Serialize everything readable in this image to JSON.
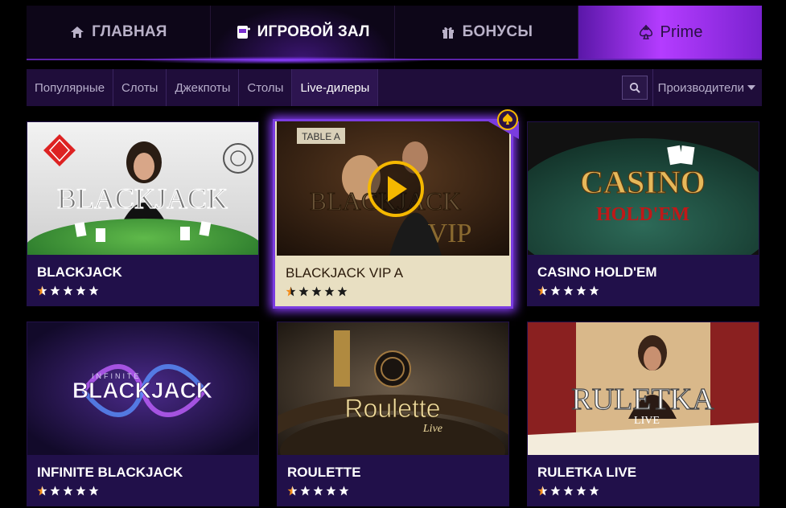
{
  "topnav": {
    "items": [
      {
        "label": "ГЛАВНАЯ",
        "icon": "home-icon"
      },
      {
        "label": "ИГРОВОЙ ЗАЛ",
        "icon": "slot-machine-icon"
      },
      {
        "label": "БОНУСЫ",
        "icon": "gift-icon"
      },
      {
        "label": "Prime",
        "icon": "prime-spade-icon"
      }
    ],
    "active": "ИГРОВОЙ ЗАЛ"
  },
  "subnav": {
    "categories": [
      "Популярные",
      "Слоты",
      "Джекпоты",
      "Столы",
      "Live-дилеры"
    ],
    "active": "Live-дилеры",
    "providers_label": "Производители"
  },
  "games": [
    {
      "title": "BLACKJACK",
      "thumb_text": "BLACKJACK",
      "rating": 1
    },
    {
      "title": "BLACKJACK VIP A",
      "thumb_text": "BLACKJACK",
      "thumb_sub": "VIP",
      "table_label": "TABLE A",
      "rating": 1
    },
    {
      "title": "CASINO HOLD'EM",
      "thumb_text": "CASINO",
      "thumb_sub": "HOLD'EM",
      "rating": 1
    },
    {
      "title": "INFINITE BLACKJACK",
      "thumb_text": "BLACKJACK",
      "thumb_pre": "INFINITE",
      "rating": 1
    },
    {
      "title": "ROULETTE",
      "thumb_text": "Roulette",
      "thumb_sub": "Live",
      "rating": 1
    },
    {
      "title": "RULETKA LIVE",
      "thumb_text": "RULETKA",
      "thumb_sub": "LIVE",
      "rating": 1
    }
  ],
  "colors": {
    "accent": "#8a3cff",
    "star_filled": "#f28c1c",
    "card_bg": "#21104a"
  }
}
